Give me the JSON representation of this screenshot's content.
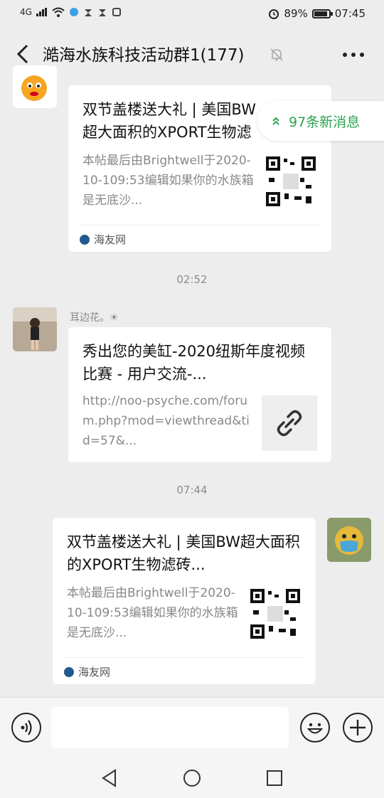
{
  "status": {
    "network": "4G",
    "battery_pct": "89%",
    "battery_level": 0.89,
    "time": "07:45"
  },
  "header": {
    "title": "澔海水族科技活动群1(177)"
  },
  "new_messages": {
    "label": "97条新消息"
  },
  "messages": [
    {
      "title": "双节盖楼送大礼 | 美国BW超大面积的XPORT生物滤砖...",
      "desc": "本帖最后由Brightwell于2020-10-109:53编辑如果你的水族箱是无底沙...",
      "source": "海友网"
    },
    {
      "time": "02:52",
      "sender": "耳边花。☀",
      "title": "秀出您的美缸-2020纽斯年度视频比赛 - 用户交流-...",
      "desc": "http://noo-psyche.com/forum.php?mod=viewthread&tid=57&..."
    },
    {
      "time": "07:44",
      "title": "双节盖楼送大礼 | 美国BW超大面积的XPORT生物滤砖...",
      "desc": "本帖最后由Brightwell于2020-10-109:53编辑如果你的水族箱是无底沙...",
      "source": "海友网"
    }
  ],
  "icons": [
    "back-arrow-icon",
    "mute-bell-icon",
    "more-icon",
    "voice-icon",
    "emoji-icon",
    "plus-icon",
    "link-icon",
    "nav-back-icon",
    "nav-home-icon",
    "nav-recents-icon"
  ],
  "colors": {
    "accent_green": "#2aa34f",
    "background": "#ededed"
  }
}
